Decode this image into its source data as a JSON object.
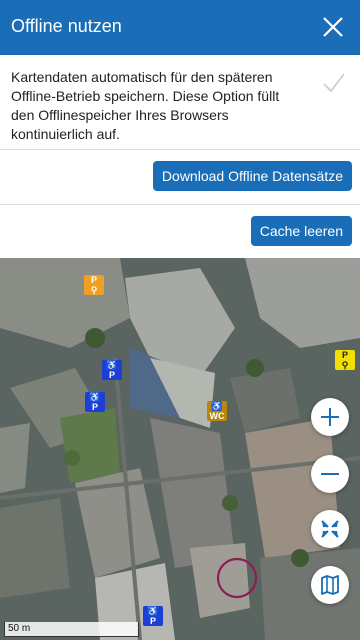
{
  "header": {
    "title": "Offline nutzen",
    "close_icon": "close-icon"
  },
  "option": {
    "text": "Kartendaten automatisch für den späteren Offline-Betrieb speichern. Diese Option füllt den Offlinespeicher Ihres Browsers kontinuierlich auf.",
    "check_icon": "check-icon"
  },
  "buttons": {
    "download_label": "Download Offline Datensätze",
    "cache_label": "Cache leeren"
  },
  "map": {
    "scale_label": "50 m",
    "controls": [
      "zoom-in-icon",
      "zoom-out-icon",
      "recenter-icon",
      "map-layers-icon"
    ],
    "poi_icons": [
      "bike-parking-icon",
      "disabled-parking-icon",
      "accessible-wc-icon"
    ],
    "colors": {
      "bike_parking": "#f0a020",
      "disabled_parking": "#1d3fd6",
      "wc": "#b8860b",
      "yellow_bike": "#f2e000"
    }
  }
}
